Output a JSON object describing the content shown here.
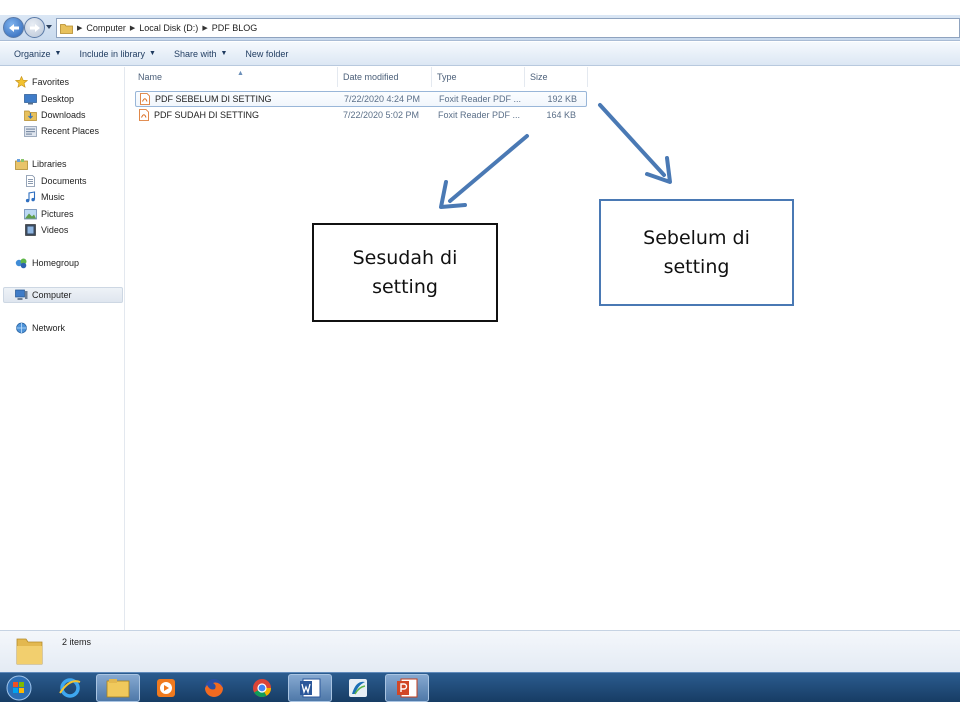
{
  "addressbar": {
    "breadcrumbs": [
      "Computer",
      "Local Disk (D:)",
      "PDF BLOG"
    ]
  },
  "toolbar": {
    "organize": "Organize",
    "include_in_library": "Include in library",
    "share_with": "Share with",
    "new_folder": "New folder"
  },
  "navpane": {
    "favorites": "Favorites",
    "desktop": "Desktop",
    "downloads": "Downloads",
    "recent_places": "Recent Places",
    "libraries": "Libraries",
    "documents": "Documents",
    "music": "Music",
    "pictures": "Pictures",
    "videos": "Videos",
    "homegroup": "Homegroup",
    "computer": "Computer",
    "network": "Network"
  },
  "columns": {
    "name": "Name",
    "date_modified": "Date modified",
    "type": "Type",
    "size": "Size"
  },
  "files": [
    {
      "name": "PDF SEBELUM DI SETTING",
      "date": "7/22/2020 4:24 PM",
      "type": "Foxit Reader PDF ...",
      "size": "192 KB"
    },
    {
      "name": "PDF SUDAH DI SETTING",
      "date": "7/22/2020 5:02 PM",
      "type": "Foxit Reader PDF ...",
      "size": "164 KB"
    }
  ],
  "annotations": {
    "sesudah_line1": "Sesudah di",
    "sesudah_line2": "setting",
    "sebelum_line1": "Sebelum di",
    "sebelum_line2": "setting"
  },
  "status": {
    "item_count": "2 items"
  },
  "colors": {
    "arrow": "#4a79b4",
    "taskbar": "#1f4a78"
  }
}
